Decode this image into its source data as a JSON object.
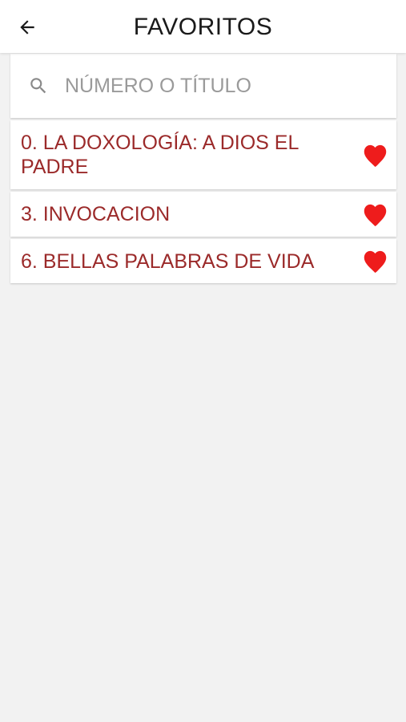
{
  "header": {
    "title": "FAVORITOS",
    "back_icon": "arrow-left-icon"
  },
  "search": {
    "placeholder": "NÚMERO O TÍTULO",
    "value": "",
    "icon": "search-icon"
  },
  "favorites": {
    "items": [
      {
        "label": "0. LA DOXOLOGÍA: A DIOS EL PADRE",
        "icon": "heart-icon"
      },
      {
        "label": "3. INVOCACION",
        "icon": "heart-icon"
      },
      {
        "label": "6. BELLAS PALABRAS DE VIDA",
        "icon": "heart-icon"
      }
    ]
  },
  "colors": {
    "item_text": "#9b2a2a",
    "heart": "#ee1c1c",
    "background": "#f2f2f2",
    "card": "#ffffff"
  }
}
